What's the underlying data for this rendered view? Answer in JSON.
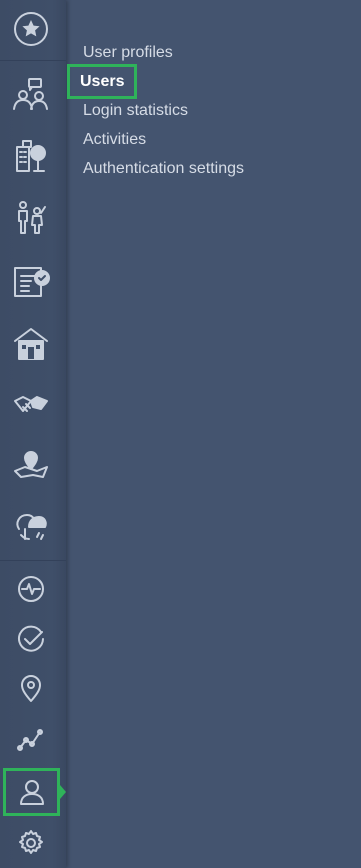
{
  "sidebar": {
    "items": [
      {
        "name": "favorites-icon"
      },
      {
        "name": "community-chat-icon"
      },
      {
        "name": "city-trees-icon"
      },
      {
        "name": "family-icon"
      },
      {
        "name": "checklist-form-icon"
      },
      {
        "name": "house-icon"
      },
      {
        "name": "handshake-icon"
      },
      {
        "name": "map-pin-icon"
      },
      {
        "name": "weather-icon"
      },
      {
        "name": "activity-pulse-icon"
      },
      {
        "name": "check-circle-icon"
      },
      {
        "name": "location-pin-icon"
      },
      {
        "name": "trend-line-icon"
      },
      {
        "name": "user-icon",
        "active": true
      },
      {
        "name": "settings-gear-icon"
      }
    ],
    "accent": "#2fb35a"
  },
  "submenu": {
    "items": [
      {
        "label": "User profiles"
      },
      {
        "label": "Users",
        "selected": true
      },
      {
        "label": "Login statistics"
      },
      {
        "label": "Activities"
      },
      {
        "label": "Authentication settings"
      }
    ]
  }
}
